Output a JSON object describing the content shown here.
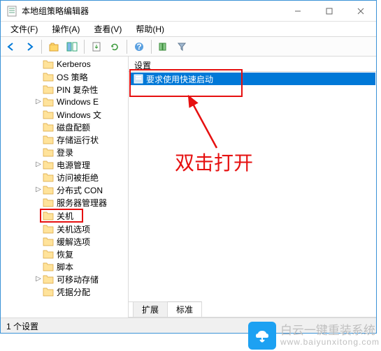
{
  "window": {
    "title": "本地组策略编辑器"
  },
  "menu": {
    "file": "文件(F)",
    "action": "操作(A)",
    "view": "查看(V)",
    "help": "帮助(H)"
  },
  "tree": {
    "items": [
      {
        "label": "Kerberos",
        "indent": 60,
        "twist": ""
      },
      {
        "label": "OS 策略",
        "indent": 60,
        "twist": ""
      },
      {
        "label": "PIN 复杂性",
        "indent": 60,
        "twist": ""
      },
      {
        "label": "Windows E",
        "indent": 60,
        "twist": "▷"
      },
      {
        "label": "Windows 文",
        "indent": 60,
        "twist": ""
      },
      {
        "label": "磁盘配额",
        "indent": 60,
        "twist": ""
      },
      {
        "label": "存储运行状",
        "indent": 60,
        "twist": ""
      },
      {
        "label": "登录",
        "indent": 60,
        "twist": ""
      },
      {
        "label": "电源管理",
        "indent": 60,
        "twist": "▷"
      },
      {
        "label": "访问被拒绝",
        "indent": 60,
        "twist": ""
      },
      {
        "label": "分布式 CON",
        "indent": 60,
        "twist": "▷"
      },
      {
        "label": "服务器管理器",
        "indent": 60,
        "twist": ""
      },
      {
        "label": "关机",
        "indent": 60,
        "twist": "",
        "hl": true
      },
      {
        "label": "关机选项",
        "indent": 60,
        "twist": ""
      },
      {
        "label": "缓解选项",
        "indent": 60,
        "twist": ""
      },
      {
        "label": "恢复",
        "indent": 60,
        "twist": ""
      },
      {
        "label": "脚本",
        "indent": 60,
        "twist": ""
      },
      {
        "label": "可移动存储",
        "indent": 60,
        "twist": "▷"
      },
      {
        "label": "凭据分配",
        "indent": 60,
        "twist": ""
      }
    ]
  },
  "list": {
    "header": "设置",
    "selected": "要求使用快速启动"
  },
  "tabs": {
    "extended": "扩展",
    "standard": "标准"
  },
  "status": "1 个设置",
  "annotation": {
    "text": "双击打开"
  },
  "watermark": {
    "brand": "白云一键重装系统",
    "url": "www.baiyunxitong.com"
  }
}
